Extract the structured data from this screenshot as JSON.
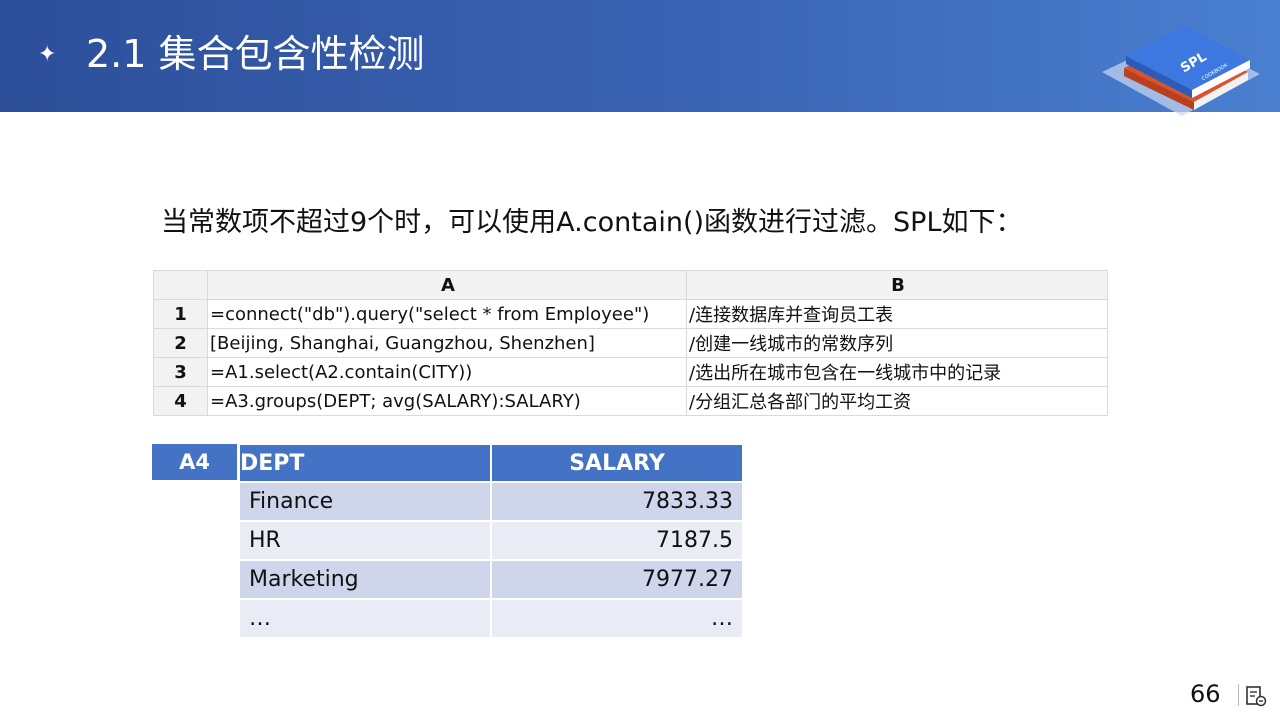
{
  "header": {
    "star": "✦",
    "title": "2.1  集合包含性检测"
  },
  "logo": {
    "text": "SPL",
    "subtext": "COOKBOOK"
  },
  "description": "当常数项不超过9个时，可以使用A.contain()函数进行过滤。SPL如下：",
  "spl_grid": {
    "columns": [
      "A",
      "B"
    ],
    "rows": [
      {
        "num": "1",
        "a": "=connect(\"db\").query(\"select * from Employee\")",
        "b": "/连接数据库并查询员工表"
      },
      {
        "num": "2",
        "a": "[Beijing, Shanghai, Guangzhou, Shenzhen]",
        "b": "/创建一线城市的常数序列"
      },
      {
        "num": "3",
        "a": "=A1.select(A2.contain(CITY))",
        "b": "/选出所在城市包含在一线城市中的记录"
      },
      {
        "num": "4",
        "a": "=A3.groups(DEPT; avg(SALARY):SALARY)",
        "b": "/分组汇总各部门的平均工资"
      }
    ]
  },
  "result": {
    "cell": "A4",
    "headers": [
      "DEPT",
      "SALARY"
    ],
    "rows": [
      [
        "Finance",
        "7833.33"
      ],
      [
        "HR",
        "7187.5"
      ],
      [
        "Marketing",
        "7977.27"
      ],
      [
        "…",
        "…"
      ]
    ]
  },
  "footer": {
    "page_number": "66",
    "icon": "slide-notes-icon"
  },
  "colors": {
    "header": "#3a64b4",
    "table_header": "#4472c4",
    "row_dark": "#cfd5ea",
    "row_light": "#e9ebf5"
  }
}
